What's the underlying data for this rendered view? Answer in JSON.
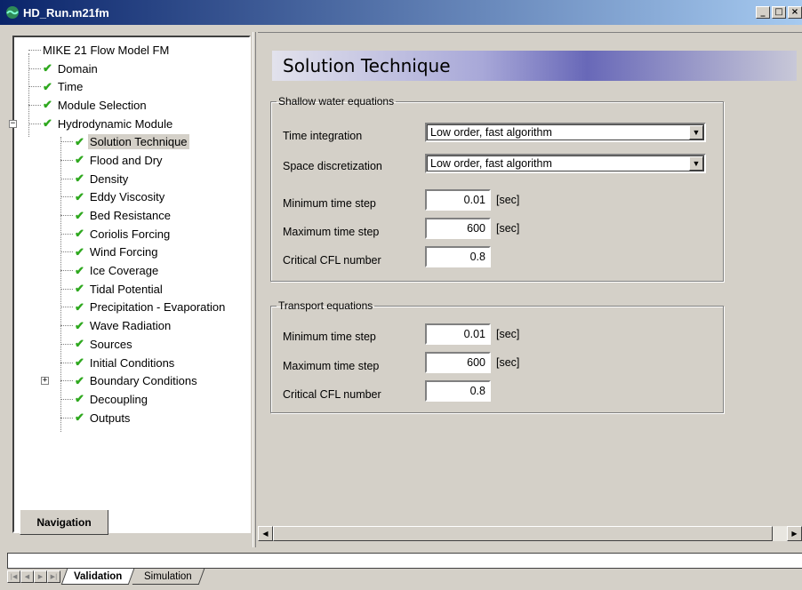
{
  "window": {
    "title": "HD_Run.m21fm",
    "minimize": "_",
    "maximize": "□",
    "close": "×"
  },
  "navigation": {
    "tab_label": "Navigation",
    "root": "MIKE 21 Flow Model FM",
    "items": [
      {
        "label": "Domain",
        "checked": true
      },
      {
        "label": "Time",
        "checked": true
      },
      {
        "label": "Module Selection",
        "checked": true
      },
      {
        "label": "Hydrodynamic Module",
        "checked": true,
        "expanded": true
      },
      {
        "label": "Solution Technique",
        "checked": true,
        "selected": true
      },
      {
        "label": "Flood and Dry",
        "checked": true
      },
      {
        "label": "Density",
        "checked": true
      },
      {
        "label": "Eddy Viscosity",
        "checked": true
      },
      {
        "label": "Bed Resistance",
        "checked": true
      },
      {
        "label": "Coriolis Forcing",
        "checked": true
      },
      {
        "label": "Wind Forcing",
        "checked": true
      },
      {
        "label": "Ice Coverage",
        "checked": true
      },
      {
        "label": "Tidal Potential",
        "checked": true
      },
      {
        "label": "Precipitation - Evaporation",
        "checked": true
      },
      {
        "label": "Wave Radiation",
        "checked": true
      },
      {
        "label": "Sources",
        "checked": true
      },
      {
        "label": "Initial Conditions",
        "checked": true
      },
      {
        "label": "Boundary Conditions",
        "checked": true,
        "expandable": true
      },
      {
        "label": "Decoupling",
        "checked": true
      },
      {
        "label": "Outputs",
        "checked": true
      }
    ]
  },
  "page": {
    "title": "Solution Technique",
    "shallow": {
      "legend": "Shallow water equations",
      "time_integration_label": "Time integration",
      "time_integration_value": "Low order, fast algorithm",
      "space_discretization_label": "Space discretization",
      "space_discretization_value": "Low order, fast algorithm",
      "min_step_label": "Minimum time step",
      "min_step_value": "0.01",
      "max_step_label": "Maximum time step",
      "max_step_value": "600",
      "cfl_label": "Critical CFL number",
      "cfl_value": "0.8",
      "unit": "[sec]"
    },
    "transport": {
      "legend": "Transport equations",
      "min_step_label": "Minimum time step",
      "min_step_value": "0.01",
      "max_step_label": "Maximum time step",
      "max_step_value": "600",
      "cfl_label": "Critical CFL number",
      "cfl_value": "0.8",
      "unit": "[sec]"
    }
  },
  "bottom_tabs": {
    "validation": "Validation",
    "simulation": "Simulation"
  },
  "colors": {
    "check": "#2ea81e",
    "titlebar": "#0a246a"
  }
}
